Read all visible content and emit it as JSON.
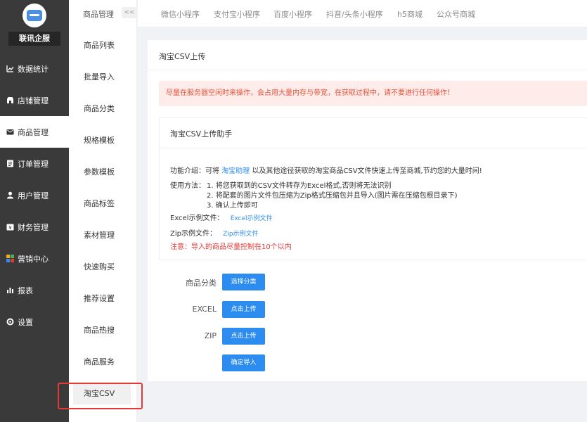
{
  "brand": {
    "name": "联讯企服"
  },
  "sidebar": {
    "items": [
      {
        "label": "数据统计",
        "icon": "chart-line-icon"
      },
      {
        "label": "店铺管理",
        "icon": "store-icon"
      },
      {
        "label": "商品管理",
        "icon": "mail-icon",
        "active": true
      },
      {
        "label": "订单管理",
        "icon": "order-icon"
      },
      {
        "label": "用户管理",
        "icon": "user-icon"
      },
      {
        "label": "财务管理",
        "icon": "finance-icon"
      },
      {
        "label": "营销中心",
        "icon": "marketing-icon"
      },
      {
        "label": "报表",
        "icon": "report-icon"
      },
      {
        "label": "设置",
        "icon": "gear-icon"
      }
    ]
  },
  "subnav": {
    "heading": "商品管理",
    "collapse": "<<",
    "items": [
      {
        "label": "商品列表"
      },
      {
        "label": "批量导入"
      },
      {
        "label": "商品分类"
      },
      {
        "label": "规格模板"
      },
      {
        "label": "参数模板"
      },
      {
        "label": "商品标签"
      },
      {
        "label": "素材管理"
      },
      {
        "label": "快速购买"
      },
      {
        "label": "推荐设置"
      },
      {
        "label": "商品热搜"
      },
      {
        "label": "商品服务"
      },
      {
        "label": "淘宝CSV",
        "active": true
      }
    ]
  },
  "tabs": [
    "微信小程序",
    "支付宝小程序",
    "百度小程序",
    "抖音/头条小程序",
    "h5商城",
    "公众号商城"
  ],
  "page": {
    "title": "淘宝CSV上传",
    "warning": "尽量在服务器空闲时来操作，会占用大量内存与带宽，在获取过程中，请不要进行任何操作！",
    "helper": {
      "title": "淘宝CSV上传助手",
      "intro_prefix": "功能介绍：可将 ",
      "intro_link": "淘宝助理",
      "intro_suffix": " 以及其他途径获取的淘宝商品CSV文件快速上传至商城,节约您的大量时间!",
      "method_label": "使用方法：",
      "steps": [
        "1. 将您获取到的CSV文件转存为Excel格式,否则将无法识别",
        "2. 将配套的图片文件包压缩为Zip格式压缩包并且导入(图片需在压缩包根目录下)",
        "3. 确认上传即可"
      ],
      "excel_label": "Excel示例文件：",
      "excel_link": "Excel示例文件",
      "zip_label": "Zip示例文件：",
      "zip_link": "Zip示例文件",
      "notice": "注意：导入的商品尽量控制在10个以内"
    },
    "form": {
      "category_label": "商品分类",
      "category_button": "选择分类",
      "excel_label": "EXCEL",
      "excel_button": "点击上传",
      "zip_label": "ZIP",
      "zip_button": "点击上传",
      "confirm_button": "确定导入"
    }
  },
  "colors": {
    "accent": "#2d8cf0",
    "sidebar_bg": "#3a3a3a",
    "warning_bg": "#fdecea",
    "warning_text": "#e5533b",
    "highlight": "#e53935"
  }
}
